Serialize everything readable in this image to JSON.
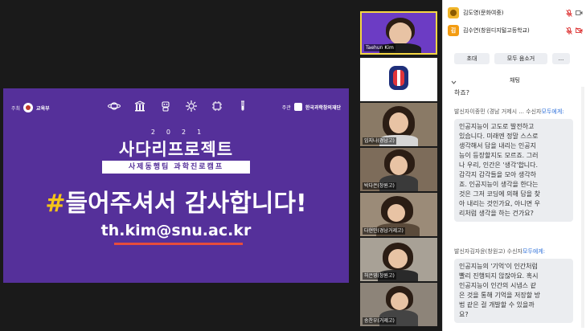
{
  "slide": {
    "host_label": "주최",
    "host_name": "교육부",
    "organizer_label": "주관",
    "organizer_name": "한국과학창의재단",
    "year": "2021",
    "title": "사다리프로젝트",
    "subtitle": "사제동행팀 과학진로캠프",
    "thanks_hash": "#",
    "thanks_text": "들어주셔서 감사합니다!",
    "email": "th.kim@snu.ac.kr",
    "icons": [
      "planet-icon",
      "building-icon",
      "robot-icon",
      "gear-icon",
      "chip-icon",
      "test-tube-icon"
    ]
  },
  "gallery": {
    "tiles": [
      {
        "name": "Taehun Kim",
        "active": true
      },
      {
        "name": "",
        "logo": true
      },
      {
        "name": "임지나(경남고)"
      },
      {
        "name": "박다은(창원고)"
      },
      {
        "name": "다현민(경남거제고)"
      },
      {
        "name": "허은영(창원고)"
      },
      {
        "name": "송찬우(거제고)"
      }
    ]
  },
  "participants": [
    {
      "name": "김도영(문화여중)",
      "avatar_letter": "",
      "avatar_color": "#f0b429"
    },
    {
      "name": "김수연(창원디지털고등학교)",
      "avatar_letter": "김",
      "avatar_color": "#f39c12"
    }
  ],
  "controls": {
    "invite": "초대",
    "mute_all": "모두 음소거",
    "more": "..."
  },
  "chat": {
    "header": "채팅",
    "partial_top": "하죠?",
    "messages": [
      {
        "sender_prefix": "발신자",
        "sender": "이종민 (경남 거제시 ...",
        "to_prefix": "수신자",
        "to": "모두에게:",
        "lines": [
          "인공지능이 고도로 발전하고",
          "있습니다. 미래엔 정말 스스로",
          "생각해서 답을 내리는 인공지",
          "능이 등장할지도 모르죠. 그러",
          "나 우리, 인간은 '생각'합니다.",
          "감각지 감각들을 모아 생각하",
          "죠. 인공지능이 생각을 한다는",
          "것은 그저 코딩에 의해 답을 찾",
          "아 내리는 것인가요, 아니면 우",
          "리처럼 생각을 하는 건가요?"
        ]
      },
      {
        "sender_prefix": "발신자",
        "sender": "김자윤(창원고)",
        "to_prefix": "수신자",
        "to": "모두에게:",
        "lines": [
          "인공지능의 '기억'이 인간처럼",
          "빨리 진행되지 않잖아요. 혹시",
          "인공지능이 인간의 시냅스 같",
          "은 것을 통해 기억을 저장할 방",
          "법 같은 걸 개발할 수 있을까",
          "요?"
        ]
      }
    ]
  },
  "colors": {
    "slide_purple": "#55309a",
    "accent_yellow": "#f5c518",
    "underline_red": "#e74c3c",
    "active_border": "#f5d742",
    "link_blue": "#2d6fd9"
  }
}
